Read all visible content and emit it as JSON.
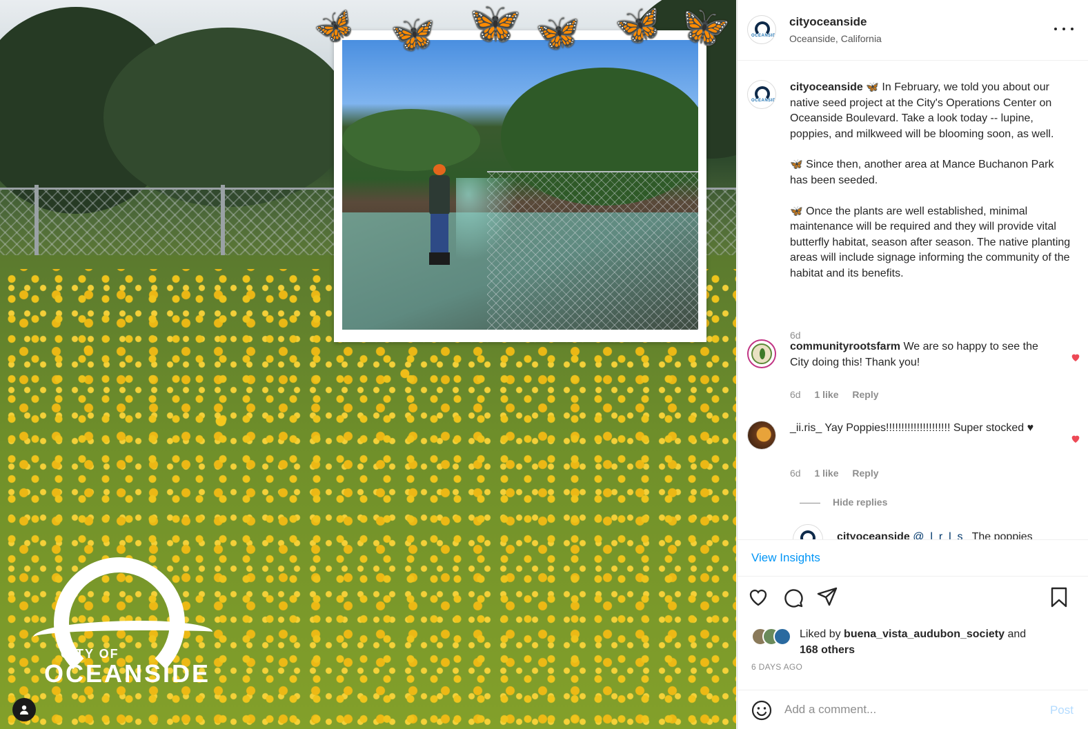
{
  "post": {
    "username": "cityoceanside",
    "location": "Oceanside, California",
    "caption": {
      "username": "cityoceanside",
      "p1": "In February, we told you about our native seed project at the City's Operations Center on Oceanside Boulevard. Take a look today -- lupine, poppies, and milkweed will be blooming soon, as well.",
      "p2": "Since then, another area at Mance Buchanon Park has been seeded.",
      "p3": "Once the plants are well established, minimal maintenance will be required and they will provide vital butterfly habitat, season after season. The native planting areas will include signage informing the community of the habitat and its benefits.",
      "time": "6d"
    },
    "comments": [
      {
        "username": "communityrootsfarm",
        "text": "We are so happy to see the City doing this! Thank you!",
        "time": "6d",
        "likes": "1 like",
        "reply": "Reply"
      },
      {
        "username": "_ii.ris_",
        "text": "Yay Poppies!!!!!!!!!!!!!!!!!!!!! Super stocked ♥",
        "time": "6d",
        "likes": "1 like",
        "reply": "Reply"
      }
    ],
    "hide_replies": "Hide replies",
    "partial_reply": {
      "username": "cityoceanside",
      "mention": "@_l_r_l_s_",
      "text": "The poppies"
    },
    "view_insights": "View Insights",
    "liked_by_prefix": "Liked by",
    "liked_by_user": "buena_vista_audubon_society",
    "liked_by_and": "and",
    "liked_by_others": "168 others",
    "posted_ago": "6 DAYS AGO",
    "comment_placeholder": "Add a comment...",
    "post_label": "Post"
  },
  "media": {
    "logo_city": "CITY OF",
    "logo_name": "OCEANSIDE"
  },
  "colors": {
    "link": "#0095f6",
    "heart": "#ed4956",
    "post_disabled": "#b3dbff"
  },
  "icons": [
    "heart-icon",
    "comment-icon",
    "share-icon",
    "bookmark-icon",
    "emoji-icon",
    "more-icon",
    "user-tag-icon",
    "butterfly-icon"
  ]
}
